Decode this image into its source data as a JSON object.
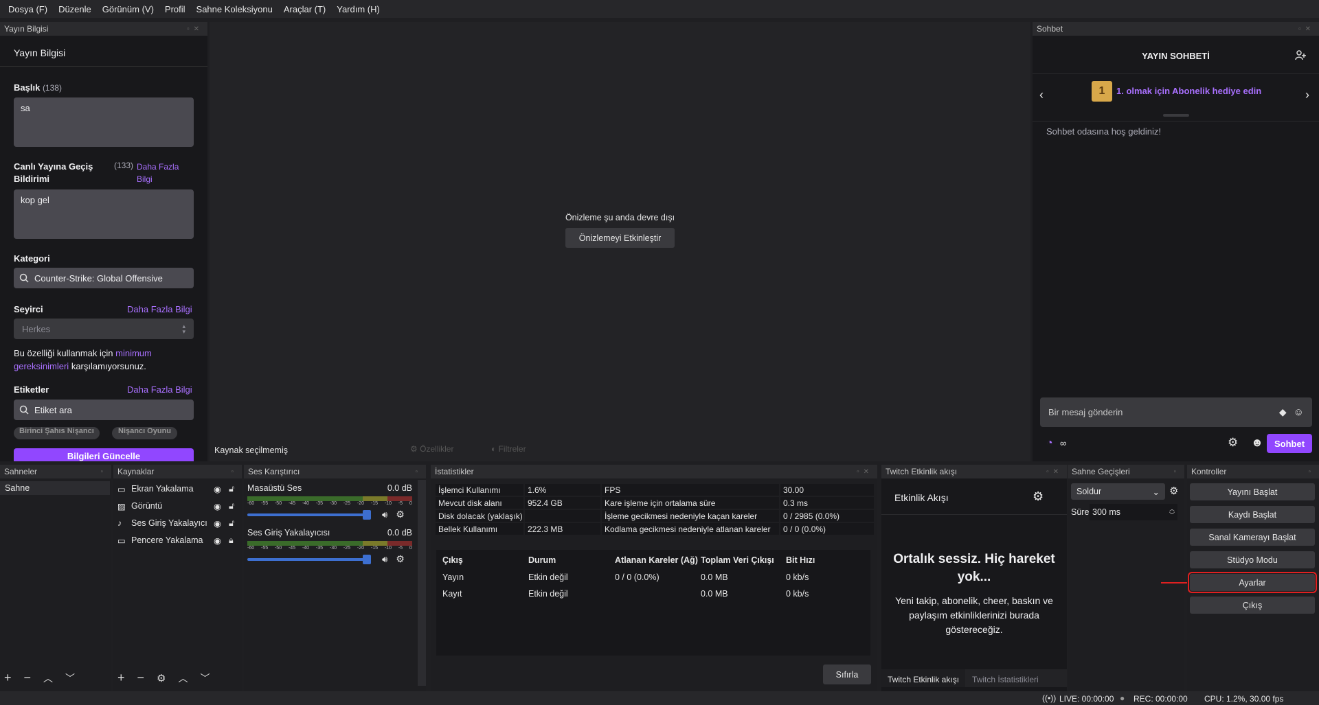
{
  "menu": [
    "Dosya (F)",
    "Düzenle",
    "Görünüm (V)",
    "Profil",
    "Sahne Koleksiyonu",
    "Araçlar (T)",
    "Yardım (H)"
  ],
  "stream_info": {
    "dock_title": "Yayın Bilgisi",
    "heading": "Yayın Bilgisi",
    "title_label": "Başlık",
    "title_count": "(138)",
    "title_value": "sa",
    "notif_label": "Canlı Yayına Geçiş Bildirimi",
    "notif_count": "(133)",
    "notif_more": "Daha Fazla Bilgi",
    "notif_value": "kop gel",
    "category_label": "Kategori",
    "category_value": "Counter-Strike: Global Offensive",
    "audience_label": "Seyirci",
    "audience_more": "Daha Fazla Bilgi",
    "audience_value": "Herkes",
    "req_text_1": "Bu özelliği kullanmak için",
    "req_link": "minimum gereksinimleri",
    "req_text_2": "karşılamıyorsunuz.",
    "tags_label": "Etiketler",
    "tags_more": "Daha Fazla Bilgi",
    "tags_placeholder": "Etiket ara",
    "tags": [
      "Birinci Şahıs Nişancı",
      "Nişancı Oyunu"
    ],
    "update_button": "Bilgileri Güncelle"
  },
  "preview": {
    "disabled_text": "Önizleme şu anda devre dışı",
    "enable_button": "Önizlemeyi Etkinleştir",
    "no_source": "Kaynak seçilmemiş",
    "properties": "Özellikler",
    "filters": "Filtreler"
  },
  "chat": {
    "dock_title": "Sohbet",
    "header": "YAYIN SOHBETİ",
    "banner": "1. olmak için Abonelik hediye edin",
    "gift_number": "1",
    "welcome": "Sohbet odasına hoş geldiniz!",
    "placeholder": "Bir mesaj gönderin",
    "infinity": "∞",
    "send_button": "Sohbet"
  },
  "scenes": {
    "title": "Sahneler",
    "items": [
      "Sahne"
    ]
  },
  "sources": {
    "title": "Kaynaklar",
    "items": [
      "Ekran Yakalama",
      "Görüntü",
      "Ses Giriş Yakalayıcı",
      "Pencere Yakalama"
    ]
  },
  "mixer": {
    "title": "Ses Karıştırıcı",
    "ticks": [
      "-60",
      "-55",
      "-50",
      "-45",
      "-40",
      "-35",
      "-30",
      "-25",
      "-20",
      "-15",
      "-10",
      "-5",
      "0"
    ],
    "channels": [
      {
        "name": "Masaüstü Ses",
        "db": "0.0 dB"
      },
      {
        "name": "Ses Giriş Yakalayıcısı",
        "db": "0.0 dB"
      }
    ]
  },
  "stats": {
    "title": "İstatistikler",
    "rows": [
      [
        "İşlemci Kullanımı",
        "1.6%",
        "FPS",
        "30.00"
      ],
      [
        "Mevcut disk alanı",
        "952.4 GB",
        "Kare işleme için ortalama süre",
        "0.3 ms"
      ],
      [
        "Disk dolacak (yaklaşık)",
        "",
        "İşleme gecikmesi nedeniyle kaçan kareler",
        "0 / 2985 (0.0%)"
      ],
      [
        "Bellek Kullanımı",
        "222.3 MB",
        "Kodlama gecikmesi nedeniyle atlanan kareler",
        "0 / 0 (0.0%)"
      ]
    ],
    "out_headers": [
      "Çıkış",
      "Durum",
      "Atlanan Kareler (Ağ)",
      "Toplam Veri Çıkışı",
      "Bit Hızı"
    ],
    "out_rows": [
      [
        "Yayın",
        "Etkin değil",
        "0 / 0 (0.0%)",
        "0.0 MB",
        "0 kb/s"
      ],
      [
        "Kayıt",
        "Etkin değil",
        "",
        "0.0 MB",
        "0 kb/s"
      ]
    ],
    "reset": "Sıfırla"
  },
  "activity": {
    "dock_title": "Twitch Etkinlik akışı",
    "heading": "Etkinlik Akışı",
    "empty_title": "Ortalık sessiz. Hiç hareket yok...",
    "empty_desc": "Yeni takip, abonelik, cheer, baskın ve paylaşım etkinliklerinizi burada göstereceğiz.",
    "tab1": "Twitch Etkinlik akışı",
    "tab2": "Twitch İstatistikleri"
  },
  "transitions": {
    "title": "Sahne Geçişleri",
    "type": "Soldur",
    "duration_label": "Süre",
    "duration": "300 ms"
  },
  "controls": {
    "title": "Kontroller",
    "buttons": [
      "Yayını Başlat",
      "Kaydı Başlat",
      "Sanal Kamerayı Başlat",
      "Stüdyo Modu",
      "Ayarlar",
      "Çıkış"
    ]
  },
  "status": {
    "live": "LIVE: 00:00:00",
    "rec": "REC: 00:00:00",
    "cpu": "CPU: 1.2%, 30.00 fps"
  },
  "colors": {
    "accent": "#a970ff",
    "highlight": "#e02020",
    "slider": "#3d6fd0"
  }
}
